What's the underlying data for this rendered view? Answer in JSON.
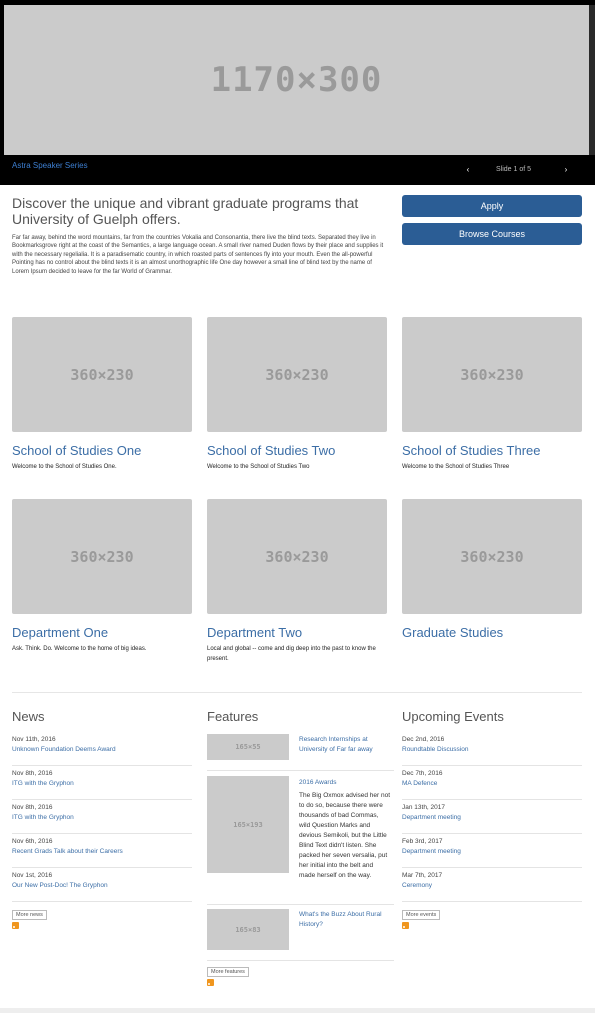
{
  "hero": {
    "image_label": "1170×300",
    "caption": "Astra Speaker Series",
    "prev_icon": "‹",
    "next_icon": "›",
    "counter": "Slide 1 of 5"
  },
  "intro": {
    "title": "Discover the unique and vibrant graduate programs that University of Guelph offers.",
    "text": "Far far away, behind the word mountains, far from the countries Vokalia and Consonantia, there live the blind texts. Separated they live in Bookmarksgrove right at the coast of the Semantics, a large language ocean. A small river named Duden flows by their place and supplies it with the necessary regelialia. It is a paradisematic country, in which roasted parts of sentences fly into your mouth. Even the all-powerful Pointing has no control about the blind texts it is an almost unorthographic life One day however a small line of blind text by the name of Lorem Ipsum decided to leave for the far World of Grammar."
  },
  "buttons": {
    "apply": "Apply",
    "browse": "Browse Courses"
  },
  "cards": [
    {
      "image_label": "360×230",
      "title": "School of Studies One",
      "desc": "Welcome to the School of Studies One."
    },
    {
      "image_label": "360×230",
      "title": "School of Studies Two",
      "desc": "Welcome to the School of Studies Two"
    },
    {
      "image_label": "360×230",
      "title": "School of Studies Three",
      "desc": "Welcome to the School of Studies Three"
    },
    {
      "image_label": "360×230",
      "title": "Department One",
      "desc": "Ask. Think. Do. Welcome to the home of big ideas."
    },
    {
      "image_label": "360×230",
      "title": "Department Two",
      "desc": "Local and global -- come and dig deep into the past to know the present."
    },
    {
      "image_label": "360×230",
      "title": "Graduate Studies",
      "desc": ""
    }
  ],
  "news": {
    "heading": "News",
    "items": [
      {
        "date": "Nov 11th, 2016",
        "title": "Unknown Foundation Deems Award"
      },
      {
        "date": "Nov 8th, 2016",
        "title": "ITG with the Gryphon"
      },
      {
        "date": "Nov 8th, 2016",
        "title": "ITG with the Gryphon"
      },
      {
        "date": "Nov 6th, 2016",
        "title": "Recent Grads Talk about their Careers"
      },
      {
        "date": "Nov 1st, 2016",
        "title": "Our New Post-Doc! The Gryphon"
      }
    ],
    "more": "More news"
  },
  "features": {
    "heading": "Features",
    "items": [
      {
        "image_label": "165×55",
        "title": "Research Internships at University of Far far away",
        "desc": ""
      },
      {
        "image_label": "165×193",
        "title": "2016 Awards",
        "desc": "The Big Oxmox advised her not to do so, because there were thousands of bad Commas, wild Question Marks and devious Semikoli, but the Little Blind Text didn't listen. She packed her seven versalia, put her initial into the belt and made herself on the way."
      },
      {
        "image_label": "165×83",
        "title": "What's the Buzz About Rural History?",
        "desc": ""
      }
    ],
    "more": "More features"
  },
  "events": {
    "heading": "Upcoming Events",
    "items": [
      {
        "date": "Dec 2nd, 2016",
        "title": "Roundtable Discussion"
      },
      {
        "date": "Dec 7th, 2016",
        "title": "MA Defence"
      },
      {
        "date": "Jan 13th, 2017",
        "title": "Department meeting"
      },
      {
        "date": "Feb 3rd, 2017",
        "title": "Department meeting"
      },
      {
        "date": "Mar 7th, 2017",
        "title": "Ceremony"
      }
    ],
    "more": "More events"
  },
  "colors": {
    "accent": "#2b5d95",
    "link": "#3c6ea6",
    "placeholder": "#cbcbcb",
    "rss": "#f0961e"
  }
}
